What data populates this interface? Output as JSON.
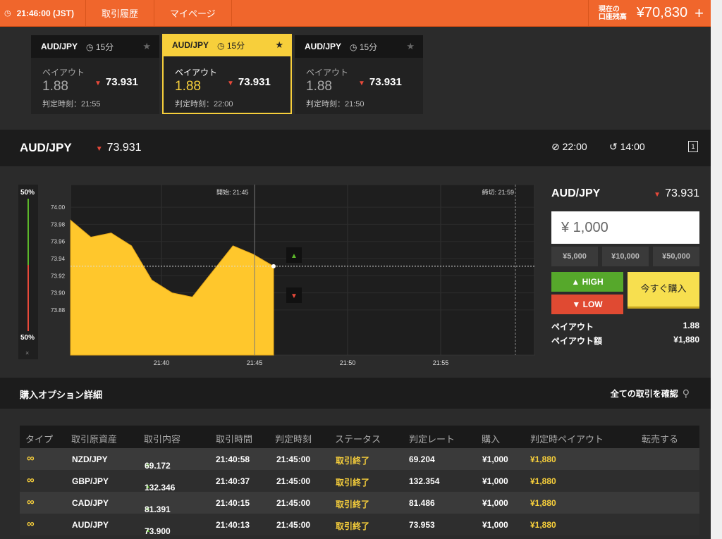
{
  "topbar": {
    "clock": "21:46:00 (JST)",
    "nav": [
      "取引履歴",
      "マイページ"
    ],
    "balance_label_1": "現在の",
    "balance_label_2": "口座残高",
    "balance": "¥70,830"
  },
  "cards": [
    {
      "pair": "AUD/JPY",
      "duration": "15分",
      "payout_label": "ペイアウト",
      "payout": "1.88",
      "rate": "73.931",
      "judge": "判定時刻：21:55"
    },
    {
      "pair": "AUD/JPY",
      "duration": "15分",
      "payout_label": "ペイアウト",
      "payout": "1.88",
      "rate": "73.931",
      "judge": "判定時刻：22:00"
    },
    {
      "pair": "AUD/JPY",
      "duration": "15分",
      "payout_label": "ペイアウト",
      "payout": "1.88",
      "rate": "73.931",
      "judge": "判定時刻：21:50"
    }
  ],
  "asset": {
    "name": "AUD/JPY",
    "rate": "73.931",
    "time_end": "22:00",
    "time_left": "14:00"
  },
  "gauge": {
    "top": "50%",
    "bottom": "50%",
    "close": "×"
  },
  "chart_data": {
    "type": "area",
    "start_label": "開始: 21:45",
    "end_label": "締切: 21:59",
    "yticks": [
      "74.00",
      "73.98",
      "73.96",
      "73.94",
      "73.92",
      "73.90",
      "73.88"
    ],
    "xticks": [
      "21:40",
      "21:45",
      "21:50",
      "21:55"
    ],
    "x": [
      "21:36",
      "21:37",
      "21:38",
      "21:39",
      "21:40",
      "21:41",
      "21:42",
      "21:43",
      "21:44",
      "21:45",
      "21:46"
    ],
    "values": [
      73.985,
      73.965,
      73.97,
      73.955,
      73.915,
      73.9,
      73.895,
      73.925,
      73.955,
      73.945,
      73.931
    ],
    "current_rate": 73.931,
    "ylim": [
      73.87,
      74.01
    ]
  },
  "panel": {
    "pair": "AUD/JPY",
    "rate": "73.931",
    "amount": "¥ 1,000",
    "quick": [
      "¥5,000",
      "¥10,000",
      "¥50,000"
    ],
    "high": "HIGH",
    "low": "LOW",
    "buy": "今すぐ購入",
    "payout_label": "ペイアウト",
    "payout": "1.88",
    "payout_amount_label": "ペイアウト額",
    "payout_amount": "¥1,880"
  },
  "section": {
    "title": "購入オプション詳細",
    "link": "全ての取引を確認"
  },
  "table": {
    "headers": [
      "タイプ",
      "取引原資産",
      "取引内容",
      "取引時間",
      "判定時刻",
      "ステータス",
      "判定レート",
      "購入",
      "判定時ペイアウト",
      "転売する"
    ],
    "rows": [
      {
        "asset": "NZD/JPY",
        "content": "69.172",
        "time": "21:40:58",
        "judge": "21:45:00",
        "status": "取引終了",
        "rate": "69.204",
        "buy": "¥1,000",
        "payout": "¥1,880"
      },
      {
        "asset": "GBP/JPY",
        "content": "132.346",
        "time": "21:40:37",
        "judge": "21:45:00",
        "status": "取引終了",
        "rate": "132.354",
        "buy": "¥1,000",
        "payout": "¥1,880"
      },
      {
        "asset": "CAD/JPY",
        "content": "81.391",
        "time": "21:40:15",
        "judge": "21:45:00",
        "status": "取引終了",
        "rate": "81.486",
        "buy": "¥1,000",
        "payout": "¥1,880"
      },
      {
        "asset": "AUD/JPY",
        "content": "73.900",
        "time": "21:40:13",
        "judge": "21:45:00",
        "status": "取引終了",
        "rate": "73.953",
        "buy": "¥1,000",
        "payout": "¥1,880"
      }
    ]
  },
  "colors": {
    "accent": "#f0662c",
    "gold": "#f7cf3b",
    "high": "#56a82b",
    "low": "#e04a32"
  }
}
